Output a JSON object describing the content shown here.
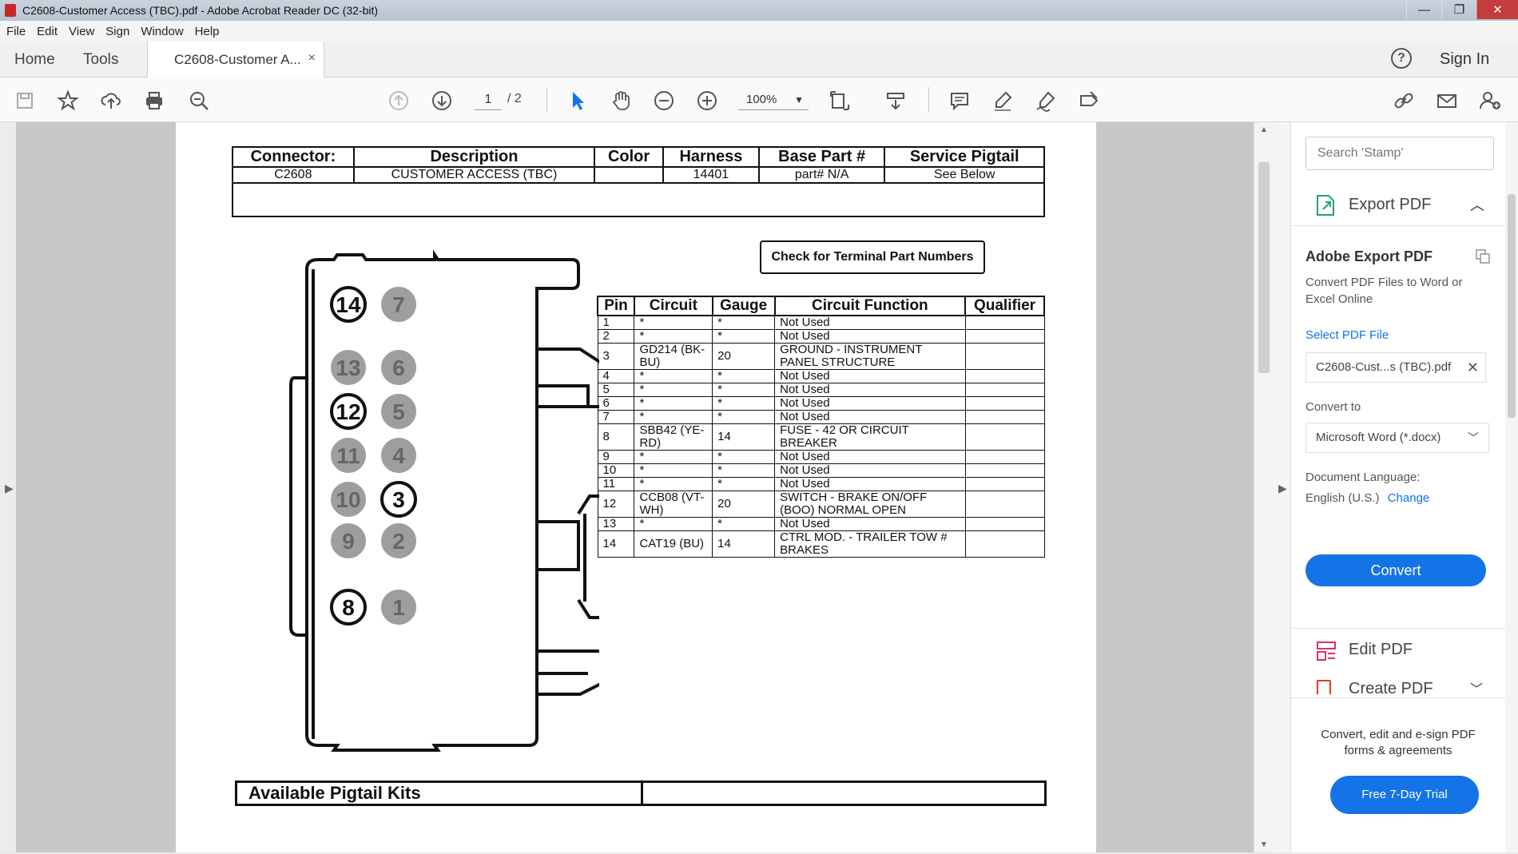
{
  "window": {
    "title": "C2608-Customer Access (TBC).pdf - Adobe Acrobat Reader DC (32-bit)",
    "min": "—",
    "max": "❐",
    "close": "✕"
  },
  "menu": [
    "File",
    "Edit",
    "View",
    "Sign",
    "Window",
    "Help"
  ],
  "tabs": {
    "home": "Home",
    "tools": "Tools",
    "doc": "C2608-Customer A...",
    "close": "×",
    "help": "?",
    "signin": "Sign In"
  },
  "toolbar": {
    "page_current": "1",
    "page_total": "/ 2",
    "zoom": "100%"
  },
  "document": {
    "header_cols": [
      "Connector:",
      "Description",
      "Color",
      "Harness",
      "Base Part #",
      "Service Pigtail"
    ],
    "header_row": [
      "C2608",
      "CUSTOMER ACCESS (TBC)",
      "",
      "14401",
      "part# N/A",
      "See Below"
    ],
    "check_button": "Check for Terminal Part Numbers",
    "pin_cols": [
      "Pin",
      "Circuit",
      "Gauge",
      "Circuit Function",
      "Qualifier"
    ],
    "pins": [
      [
        "1",
        "*",
        "*",
        "Not Used",
        ""
      ],
      [
        "2",
        "*",
        "*",
        "Not Used",
        ""
      ],
      [
        "3",
        "GD214 (BK-BU)",
        "20",
        "GROUND - INSTRUMENT PANEL STRUCTURE",
        ""
      ],
      [
        "4",
        "*",
        "*",
        "Not Used",
        ""
      ],
      [
        "5",
        "*",
        "*",
        "Not Used",
        ""
      ],
      [
        "6",
        "*",
        "*",
        "Not Used",
        ""
      ],
      [
        "7",
        "*",
        "*",
        "Not Used",
        ""
      ],
      [
        "8",
        "SBB42 (YE-RD)",
        "14",
        "FUSE - 42 OR CIRCUIT BREAKER",
        ""
      ],
      [
        "9",
        "*",
        "*",
        "Not Used",
        ""
      ],
      [
        "10",
        "*",
        "*",
        "Not Used",
        ""
      ],
      [
        "11",
        "*",
        "*",
        "Not Used",
        ""
      ],
      [
        "12",
        "CCB08 (VT-WH)",
        "20",
        "SWITCH - BRAKE ON/OFF (BOO) NORMAL OPEN",
        ""
      ],
      [
        "13",
        "*",
        "*",
        "Not Used",
        ""
      ],
      [
        "14",
        "CAT19 (BU)",
        "14",
        "CTRL MOD. - TRAILER TOW # BRAKES",
        ""
      ]
    ],
    "connector_pins": {
      "left": [
        "14",
        "13",
        "12",
        "11",
        "10",
        "9",
        "8"
      ],
      "right": [
        "7",
        "6",
        "5",
        "4",
        "3",
        "2",
        "1"
      ],
      "active": [
        "14",
        "12",
        "8",
        "3"
      ]
    },
    "pigtail_label": "Available Pigtail Kits"
  },
  "right_panel": {
    "search_placeholder": "Search 'Stamp'",
    "export_label": "Export PDF",
    "title": "Adobe Export PDF",
    "description": "Convert PDF Files to Word or Excel Online",
    "select_link": "Select PDF File",
    "file_name": "C2608-Cust...s (TBC).pdf",
    "convert_to_label": "Convert to",
    "convert_format": "Microsoft Word (*.docx)",
    "doc_lang_label": "Document Language:",
    "doc_lang": "English (U.S.)",
    "change_link": "Change",
    "convert_button": "Convert",
    "edit_label": "Edit PDF",
    "create_label": "Create PDF",
    "promo_text": "Convert, edit and e-sign PDF forms & agreements",
    "trial_button": "Free 7-Day Trial"
  },
  "colors": {
    "accent": "#1473e6",
    "inactive_pin": "#9e9e9e"
  }
}
